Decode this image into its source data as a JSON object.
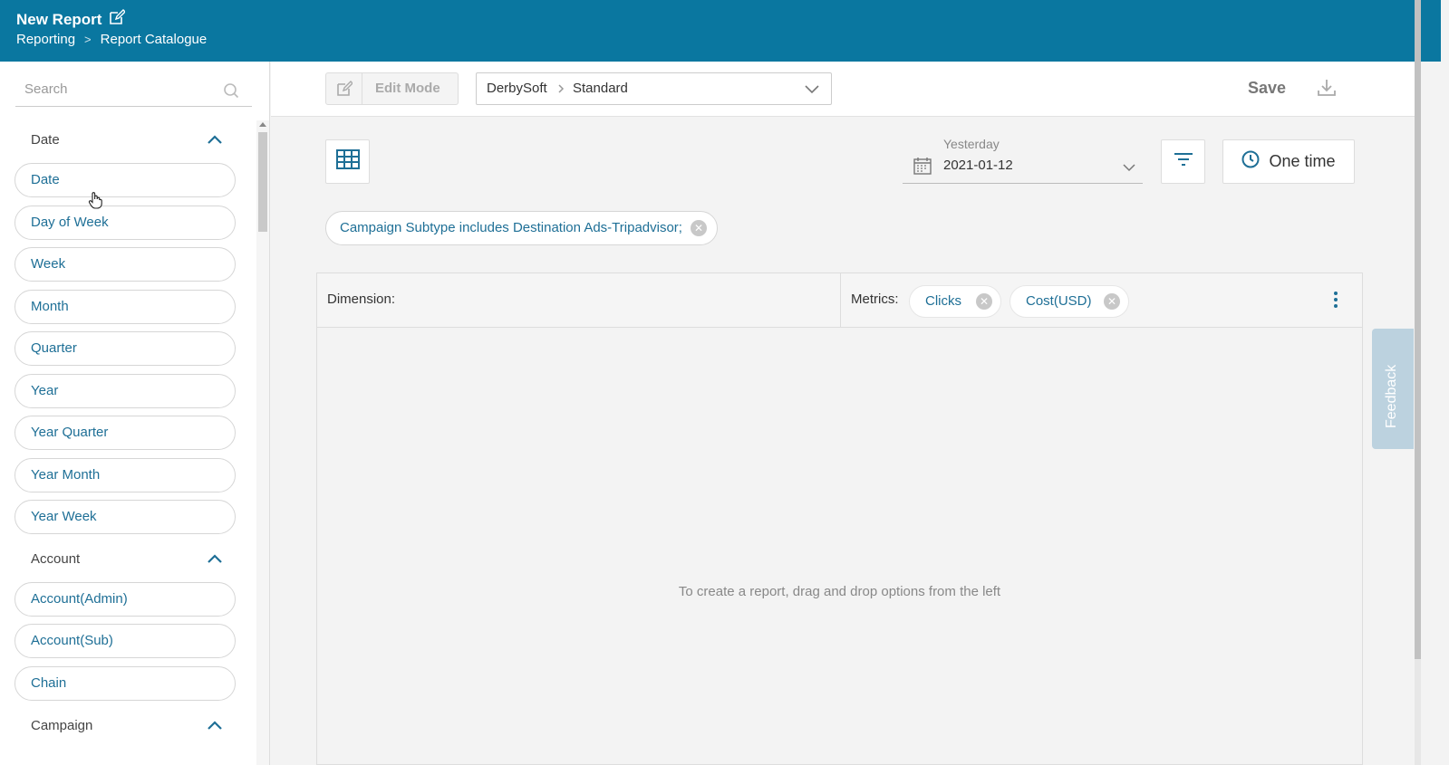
{
  "header": {
    "title": "New Report",
    "breadcrumbs": [
      "Reporting",
      ">",
      "Report Catalogue"
    ]
  },
  "sidebar": {
    "search_placeholder": "Search",
    "groups": [
      {
        "label": "Date",
        "items": [
          "Date",
          "Day of Week",
          "Week",
          "Month",
          "Quarter",
          "Year",
          "Year Quarter",
          "Year Month",
          "Year Week"
        ]
      },
      {
        "label": "Account",
        "items": [
          "Account(Admin)",
          "Account(Sub)",
          "Chain"
        ]
      },
      {
        "label": "Campaign",
        "items": []
      }
    ]
  },
  "toolbar": {
    "edit_mode_label": "Edit Mode",
    "selector_account": "DerbySoft",
    "selector_view": "Standard",
    "save_label": "Save"
  },
  "controls": {
    "date_label": "Yesterday",
    "date_value": "2021-01-12",
    "schedule_label": "One time"
  },
  "filter_chip": "Campaign Subtype includes Destination Ads-Tripadvisor;",
  "report": {
    "dimension_label": "Dimension:",
    "metrics_label": "Metrics:",
    "metrics": [
      "Clicks",
      "Cost(USD)"
    ],
    "empty_message": "To create a report, drag and drop options from the left"
  },
  "feedback_label": "Feedback",
  "colors": {
    "brand": "#0a77a0",
    "link": "#1e6f96"
  }
}
